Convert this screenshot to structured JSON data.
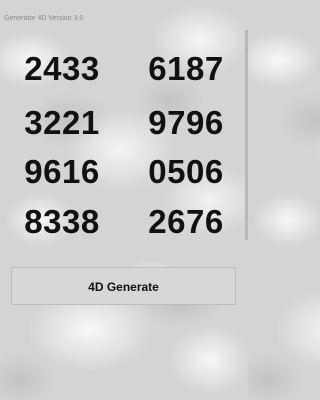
{
  "app": {
    "title": "Generator 4D Version 3.0"
  },
  "numbers": [
    "2433",
    "6187",
    "3221",
    "9796",
    "9616",
    "0506",
    "8338",
    "2676"
  ],
  "actions": {
    "generate_label": "4D Generate"
  }
}
